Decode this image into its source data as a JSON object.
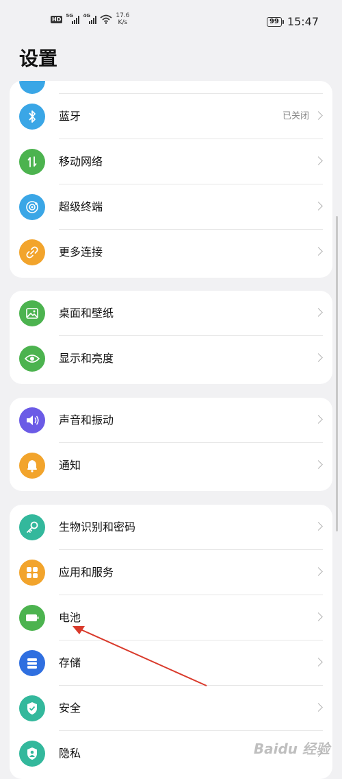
{
  "status_bar": {
    "hd": "HD",
    "sim1": "5G",
    "sim2": "4G",
    "speed_value": "17.6",
    "speed_unit": "K/s",
    "battery": "99",
    "time": "15:47"
  },
  "page_title": "设置",
  "groups": [
    {
      "items": [
        {
          "label": "蓝牙",
          "value": "已关闭",
          "icon": "bluetooth-icon",
          "color": "#3aa6e6"
        },
        {
          "label": "移动网络",
          "icon": "mobile-data-icon",
          "color": "#4cb34f"
        },
        {
          "label": "超级终端",
          "icon": "super-device-icon",
          "color": "#3aa6e6"
        },
        {
          "label": "更多连接",
          "icon": "link-icon",
          "color": "#f2a42c"
        }
      ]
    },
    {
      "items": [
        {
          "label": "桌面和壁纸",
          "icon": "wallpaper-icon",
          "color": "#4cb34f"
        },
        {
          "label": "显示和亮度",
          "icon": "eye-icon",
          "color": "#4cb34f"
        }
      ]
    },
    {
      "items": [
        {
          "label": "声音和振动",
          "icon": "speaker-icon",
          "color": "#6b5be6"
        },
        {
          "label": "通知",
          "icon": "bell-icon",
          "color": "#f2a42c"
        }
      ]
    },
    {
      "items": [
        {
          "label": "生物识别和密码",
          "icon": "key-icon",
          "color": "#33b89c"
        },
        {
          "label": "应用和服务",
          "icon": "apps-icon",
          "color": "#f2a42c"
        },
        {
          "label": "电池",
          "icon": "battery-icon",
          "color": "#4cb34f"
        },
        {
          "label": "存储",
          "icon": "storage-icon",
          "color": "#2f6fe0"
        },
        {
          "label": "安全",
          "icon": "shield-check-icon",
          "color": "#33b89c"
        },
        {
          "label": "隐私",
          "icon": "privacy-icon",
          "color": "#33b89c"
        }
      ]
    }
  ],
  "watermark": "Baidu 经验"
}
